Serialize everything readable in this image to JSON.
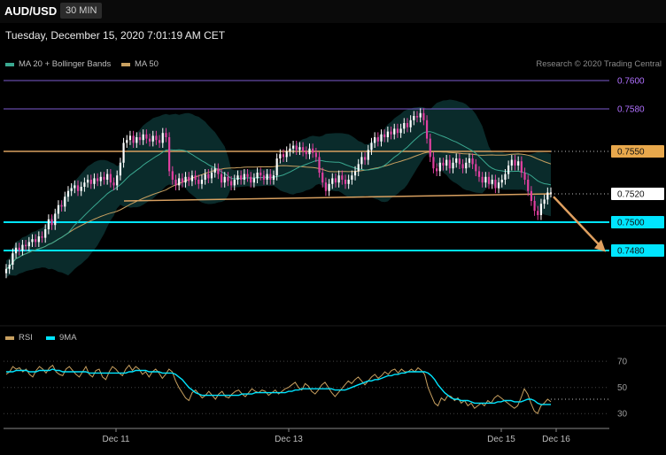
{
  "header": {
    "symbol": "AUD/USD",
    "timeframe": "30 MIN",
    "datetime": "Tuesday, December 15, 2020 7:01:19 AM CET"
  },
  "legend": {
    "ma20": "MA 20 + Bollinger Bands",
    "ma50": "MA 50",
    "credit": "Research © 2020 Trading Central"
  },
  "rsi_legend": {
    "rsi": "RSI",
    "ma9": "9MA"
  },
  "colors": {
    "background": "#000000",
    "bull": "#ffffff",
    "bear": "#e040a0",
    "ma20": "#3aa890",
    "ma50": "#c8a060",
    "band_fill": "#0e3a3a",
    "resistance": "#d8a060",
    "support": "#00e5ff",
    "target_line": "#7b5ccf",
    "target_label": "#b070ff",
    "arrow": "#e0a060"
  },
  "chart_data": [
    {
      "type": "candlestick",
      "title": "",
      "x_ticks": [
        "Dec 11",
        "Dec 13",
        "Dec 15",
        "Dec 16"
      ],
      "ylim": [
        0.7445,
        0.7615
      ],
      "price_levels": [
        {
          "label": "0.7600",
          "value": 0.76,
          "kind": "target"
        },
        {
          "label": "0.7580",
          "value": 0.758,
          "kind": "target"
        },
        {
          "label": "0.7550",
          "value": 0.755,
          "kind": "resistance"
        },
        {
          "label": "0.7520",
          "value": 0.752,
          "kind": "current"
        },
        {
          "label": "0.7500",
          "value": 0.75,
          "kind": "support"
        },
        {
          "label": "0.7480",
          "value": 0.748,
          "kind": "support"
        }
      ],
      "trendline": {
        "from": [
          0.7515
        ],
        "to": [
          0.752
        ]
      },
      "closes": [
        0.7467,
        0.747,
        0.7478,
        0.7482,
        0.748,
        0.7484,
        0.7483,
        0.7486,
        0.7488,
        0.7486,
        0.749,
        0.7489,
        0.7495,
        0.7502,
        0.7498,
        0.7506,
        0.7512,
        0.7511,
        0.7518,
        0.7522,
        0.7524,
        0.7526,
        0.7522,
        0.7525,
        0.7528,
        0.753,
        0.7527,
        0.7531,
        0.7529,
        0.7532,
        0.753,
        0.7534,
        0.7528,
        0.7526,
        0.7533,
        0.7542,
        0.7556,
        0.7558,
        0.7561,
        0.7556,
        0.756,
        0.7558,
        0.7562,
        0.7559,
        0.7557,
        0.7561,
        0.7558,
        0.7556,
        0.7563,
        0.756,
        0.7536,
        0.753,
        0.7526,
        0.7531,
        0.7528,
        0.7532,
        0.7529,
        0.7533,
        0.753,
        0.7527,
        0.753,
        0.7534,
        0.7531,
        0.7535,
        0.7538,
        0.7534,
        0.7528,
        0.7532,
        0.7529,
        0.7526,
        0.753,
        0.7533,
        0.753,
        0.7534,
        0.7532,
        0.7528,
        0.7531,
        0.7535,
        0.7533,
        0.753,
        0.7534,
        0.753,
        0.7533,
        0.7545,
        0.7548,
        0.7546,
        0.755,
        0.7552,
        0.7554,
        0.7551,
        0.7553,
        0.755,
        0.7548,
        0.7552,
        0.7549,
        0.7546,
        0.7535,
        0.7528,
        0.7522,
        0.7527,
        0.7531,
        0.7528,
        0.7533,
        0.753,
        0.7527,
        0.753,
        0.7533,
        0.7536,
        0.7541,
        0.7546,
        0.7544,
        0.7551,
        0.7556,
        0.756,
        0.7557,
        0.7562,
        0.756,
        0.7564,
        0.7562,
        0.7566,
        0.7563,
        0.7566,
        0.757,
        0.7567,
        0.7572,
        0.7575,
        0.7574,
        0.7577,
        0.7572,
        0.7559,
        0.7546,
        0.7538,
        0.7536,
        0.7542,
        0.754,
        0.7544,
        0.7538,
        0.7542,
        0.7545,
        0.7541,
        0.7538,
        0.7542,
        0.7545,
        0.7541,
        0.7536,
        0.7532,
        0.7528,
        0.7532,
        0.7527,
        0.753,
        0.7524,
        0.7528,
        0.753,
        0.7534,
        0.754,
        0.7544,
        0.754,
        0.7543,
        0.7535,
        0.753,
        0.7522,
        0.7515,
        0.7508,
        0.7505,
        0.7513,
        0.7516,
        0.7521,
        0.7521
      ],
      "ma_markers": [
        0.753,
        0.7545,
        0.755
      ]
    },
    {
      "type": "line",
      "title": "",
      "series": [
        {
          "name": "RSI",
          "values": [
            60,
            62,
            66,
            64,
            65,
            62,
            64,
            60,
            58,
            63,
            66,
            64,
            61,
            65,
            67,
            62,
            60,
            59,
            64,
            66,
            63,
            60,
            58,
            62,
            66,
            60,
            58,
            63,
            64,
            58,
            56,
            62,
            66,
            64,
            61,
            59,
            64,
            67,
            63,
            66,
            64,
            60,
            62,
            58,
            62,
            64,
            61,
            57,
            60,
            64,
            62,
            55,
            50,
            46,
            42,
            40,
            46,
            48,
            45,
            42,
            44,
            47,
            44,
            41,
            45,
            47,
            43,
            42,
            45,
            47,
            48,
            45,
            43,
            46,
            49,
            47,
            46,
            48,
            47,
            44,
            46,
            48,
            45,
            47,
            49,
            50,
            52,
            54,
            50,
            48,
            53,
            51,
            47,
            45,
            48,
            52,
            54,
            50,
            46,
            43,
            46,
            49,
            52,
            55,
            53,
            56,
            58,
            55,
            52,
            55,
            58,
            60,
            57,
            59,
            62,
            60,
            63,
            64,
            61,
            64,
            62,
            62,
            64,
            62,
            65,
            63,
            60,
            50,
            44,
            38,
            36,
            42,
            40,
            44,
            43,
            40,
            42,
            38,
            40,
            36,
            38,
            34,
            36,
            38,
            36,
            40,
            38,
            42,
            44,
            42,
            40,
            38,
            36,
            34,
            36,
            42,
            49,
            45,
            38,
            32,
            30,
            36,
            38,
            41,
            39
          ]
        },
        {
          "name": "9MA",
          "values": [
            62,
            62,
            62,
            63,
            63,
            63,
            63,
            62,
            62,
            62,
            63,
            63,
            63,
            63,
            64,
            63,
            63,
            62,
            62,
            62,
            62,
            62,
            62,
            62,
            62,
            61,
            61,
            61,
            61,
            61,
            61,
            61,
            61,
            61,
            61,
            61,
            61,
            62,
            62,
            63,
            63,
            63,
            63,
            62,
            62,
            62,
            62,
            61,
            61,
            61,
            61,
            60,
            58,
            56,
            53,
            50,
            48,
            46,
            45,
            44,
            44,
            44,
            44,
            44,
            44,
            44,
            44,
            44,
            44,
            44,
            44,
            45,
            45,
            45,
            45,
            46,
            46,
            46,
            46,
            46,
            46,
            46,
            46,
            46,
            46,
            47,
            47,
            48,
            48,
            49,
            49,
            49,
            49,
            49,
            49,
            49,
            49,
            49,
            49,
            48,
            48,
            48,
            48,
            49,
            50,
            51,
            52,
            53,
            54,
            55,
            55,
            56,
            56,
            57,
            58,
            59,
            59,
            60,
            60,
            61,
            61,
            62,
            62,
            62,
            62,
            62,
            62,
            61,
            59,
            56,
            52,
            49,
            46,
            44,
            42,
            41,
            41,
            40,
            40,
            40,
            39,
            38,
            38,
            38,
            38,
            38,
            38,
            38,
            39,
            39,
            40,
            40,
            40,
            39,
            39,
            39,
            40,
            41,
            41,
            40,
            38,
            37,
            37,
            37,
            37
          ]
        }
      ],
      "ylim": [
        20,
        85
      ],
      "y_ticks": [
        "70",
        "50",
        "30"
      ]
    }
  ]
}
